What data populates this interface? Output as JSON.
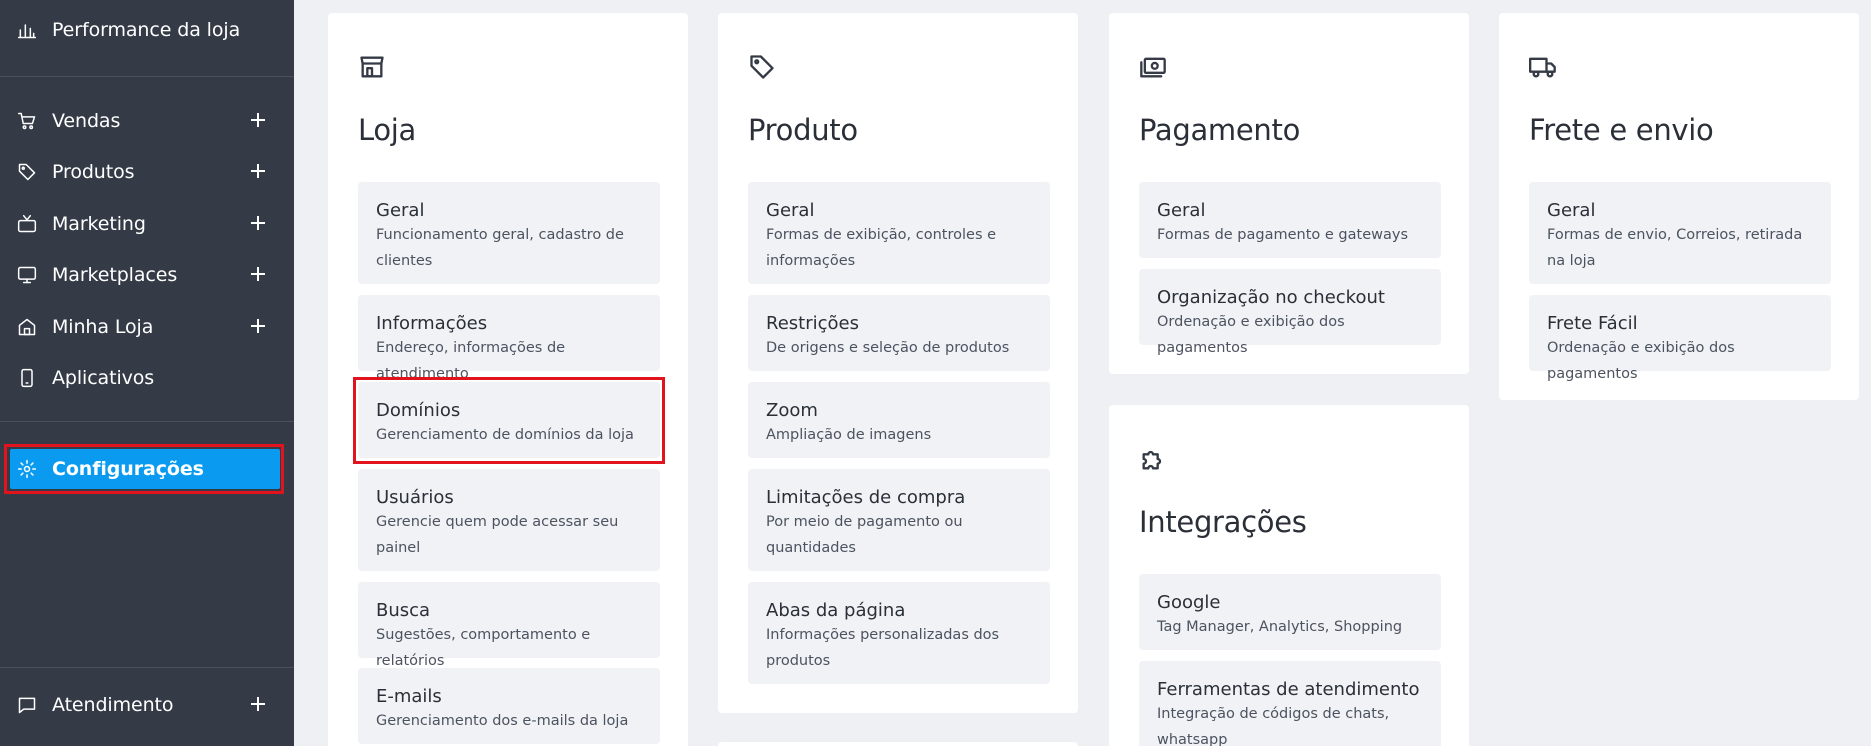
{
  "sidebar": {
    "top_item": "Performance da loja",
    "items": [
      {
        "label": "Vendas",
        "icon": "cart-icon",
        "expandable": true
      },
      {
        "label": "Produtos",
        "icon": "tag-icon",
        "expandable": true
      },
      {
        "label": "Marketing",
        "icon": "tv-icon",
        "expandable": true
      },
      {
        "label": "Marketplaces",
        "icon": "monitor-icon",
        "expandable": true
      },
      {
        "label": "Minha Loja",
        "icon": "home-icon",
        "expandable": true
      },
      {
        "label": "Aplicativos",
        "icon": "smartphone-icon",
        "expandable": false
      }
    ],
    "active_item": "Configurações",
    "bottom_item": "Atendimento"
  },
  "cards": {
    "loja": {
      "title": "Loja",
      "icon": "store-icon",
      "options": [
        {
          "title": "Geral",
          "desc": "Funcionamento geral, cadastro de clientes"
        },
        {
          "title": "Informações",
          "desc": "Endereço, informações de atendimento"
        },
        {
          "title": "Domínios",
          "desc": "Gerenciamento de domínios da loja"
        },
        {
          "title": "Usuários",
          "desc": "Gerencie quem pode acessar seu painel"
        },
        {
          "title": "Busca",
          "desc": "Sugestões, comportamento e relatórios"
        },
        {
          "title": "E-mails",
          "desc": "Gerenciamento dos e-mails da loja"
        }
      ]
    },
    "produto": {
      "title": "Produto",
      "icon": "tag-icon",
      "options": [
        {
          "title": "Geral",
          "desc": "Formas de exibição, controles e informações"
        },
        {
          "title": "Restrições",
          "desc": "De origens e seleção de produtos"
        },
        {
          "title": "Zoom",
          "desc": "Ampliação de imagens"
        },
        {
          "title": "Limitações de compra",
          "desc": "Por meio de pagamento ou quantidades"
        },
        {
          "title": "Abas da página",
          "desc": "Informações personalizadas dos produtos"
        }
      ]
    },
    "pagamento": {
      "title": "Pagamento",
      "icon": "money-icon",
      "options": [
        {
          "title": "Geral",
          "desc": "Formas de pagamento e gateways"
        },
        {
          "title": "Organização no checkout",
          "desc": "Ordenação e exibição dos pagamentos"
        }
      ]
    },
    "integracoes": {
      "title": "Integrações",
      "icon": "puzzle-icon",
      "options": [
        {
          "title": "Google",
          "desc": "Tag Manager, Analytics, Shopping"
        },
        {
          "title": "Ferramentas de atendimento",
          "desc": "Integração de códigos de chats, whatsapp"
        }
      ]
    },
    "frete": {
      "title": "Frete e envio",
      "icon": "truck-icon",
      "options": [
        {
          "title": "Geral",
          "desc": "Formas de envio, Correios, retirada na loja"
        },
        {
          "title": "Frete Fácil",
          "desc": "Ordenação e exibição dos pagamentos"
        }
      ]
    }
  },
  "colors": {
    "sidebar_bg": "#343a46",
    "active_bg": "#0a9bf0",
    "highlight": "#e1141d",
    "page_bg": "#eef0f3"
  }
}
